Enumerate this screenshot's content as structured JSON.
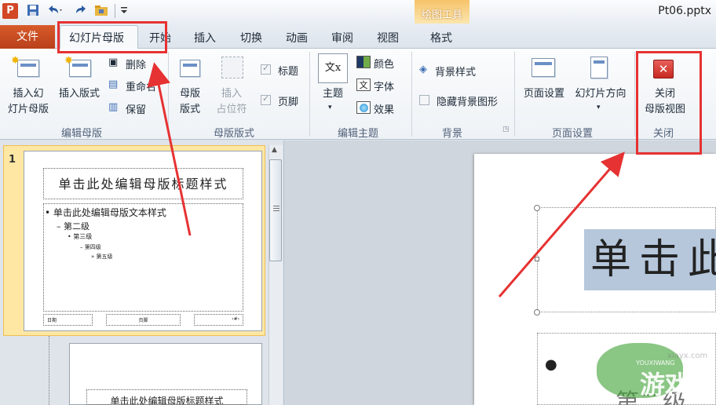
{
  "window": {
    "title": "Pt06.pptx"
  },
  "quick_access": {
    "app_icon": "P",
    "icons": [
      "save-icon",
      "undo-icon",
      "redo-icon",
      "folder-icon",
      "customize-icon"
    ]
  },
  "contextual_tab_group": "绘图工具",
  "tabs": [
    "文件",
    "幻灯片母版",
    "开始",
    "插入",
    "切换",
    "动画",
    "审阅",
    "视图",
    "格式"
  ],
  "active_tab": "幻灯片母版",
  "ribbon": {
    "groups": {
      "edit_master": "编辑母版",
      "master_layout": "母版版式",
      "edit_theme": "编辑主题",
      "background": "背景",
      "page_setup": "页面设置",
      "close": "关闭"
    },
    "buttons": {
      "insert_slide_master": "插入幻灯片母版",
      "insert_slide_master_l1": "插入幻",
      "insert_slide_master_l2": "灯片母版",
      "insert_layout": "插入版式",
      "delete": "删除",
      "rename": "重命名",
      "preserve": "保留",
      "master_layout_l1": "母版",
      "master_layout_l2": "版式",
      "insert_placeholder_l1": "插入",
      "insert_placeholder_l2": "占位符",
      "title": "标题",
      "footer": "页脚",
      "theme": "主题",
      "colors": "颜色",
      "fonts": "字体",
      "effects": "效果",
      "background_styles": "背景样式",
      "hide_background": "隐藏背景图形",
      "page_setup": "页面设置",
      "slide_orientation": "幻灯片方向",
      "close_master_l1": "关闭",
      "close_master_l2": "母版视图"
    }
  },
  "thumbnails": [
    {
      "number": "1",
      "title": "单击此处编辑母版标题样式",
      "body": [
        "单击此处编辑母版文本样式",
        "第二级",
        "第三级",
        "第四级",
        "第五级"
      ],
      "footer": [
        "日期",
        "页脚",
        "‹#›"
      ]
    },
    {
      "number": "",
      "title": "单击此处编辑母版标题样式"
    }
  ],
  "canvas": {
    "title_fragment": "单击此",
    "body_fragment": "第二级"
  },
  "watermark": {
    "brand": "游戏",
    "sub": "YOUXIWANG",
    "url": "xiayx.com"
  },
  "colors": {
    "file_tab": "#d24726",
    "highlight_red": "#e63232",
    "context_tab": "#f6c36a",
    "selected_thumb": "#fde7a3"
  }
}
